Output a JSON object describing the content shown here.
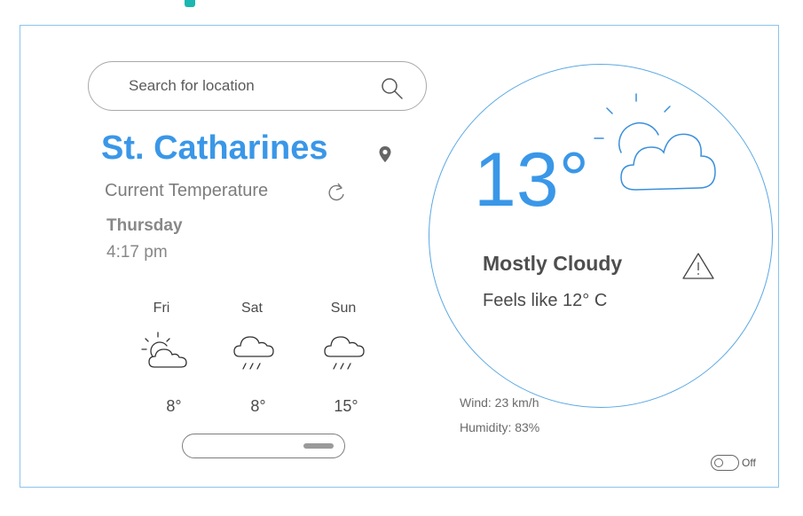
{
  "search": {
    "placeholder": "Search for location"
  },
  "location": {
    "city": "St. Catharines"
  },
  "current": {
    "label": "Current Temperature",
    "day": "Thursday",
    "time": "4:17 pm",
    "temperature": "13°",
    "condition": "Mostly Cloudy",
    "feels_like": "Feels like 12° C",
    "wind": "Wind: 23 km/h",
    "humidity": "Humidity: 83%"
  },
  "forecast": [
    {
      "day": "Fri",
      "temp": "8°",
      "icon": "partly-cloudy-icon"
    },
    {
      "day": "Sat",
      "temp": "8°",
      "icon": "rain-cloud-icon"
    },
    {
      "day": "Sun",
      "temp": "15°",
      "icon": "rain-cloud-icon"
    }
  ],
  "toggle": {
    "label": "Off"
  },
  "colors": {
    "accent": "#3a97e8",
    "teal": "#1bb7b0",
    "border": "#8cc4ec"
  }
}
